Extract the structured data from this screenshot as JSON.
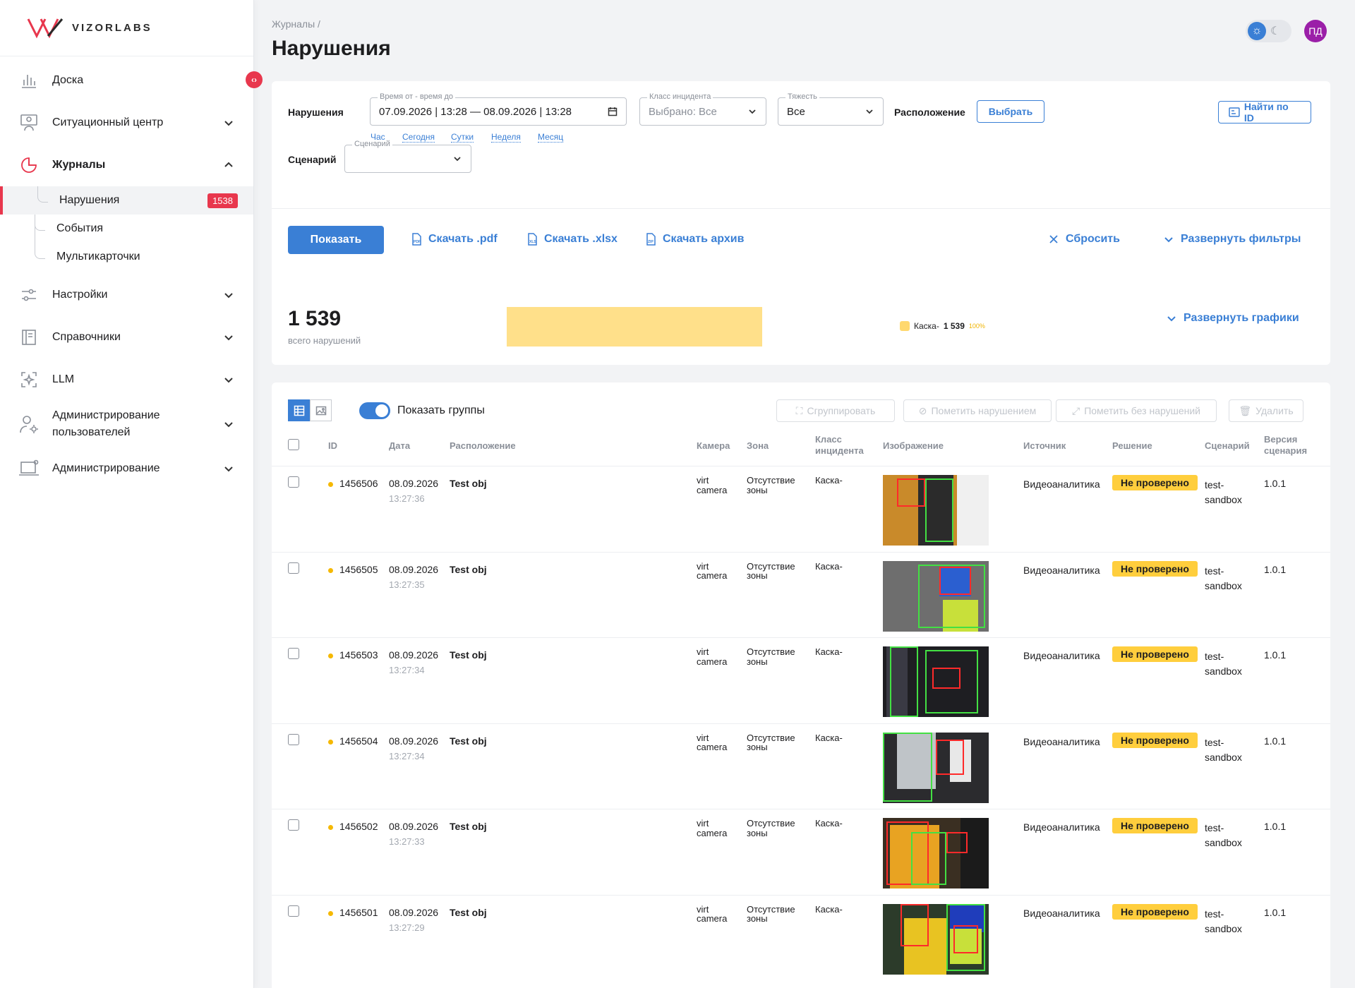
{
  "brand": {
    "logo_text": "VIZORLABS",
    "accent": "#e8374d",
    "primary": "#3a7fd5"
  },
  "sidebar": {
    "items": [
      {
        "label": "Доска",
        "icon": "chart-bars-icon"
      },
      {
        "label": "Ситуационный центр",
        "icon": "monitor-user-icon"
      },
      {
        "label": "Журналы",
        "icon": "pie-chart-icon"
      },
      {
        "label": "Настройки",
        "icon": "sliders-icon"
      },
      {
        "label": "Справочники",
        "icon": "book-icon"
      },
      {
        "label": "LLM",
        "icon": "ai-sparkle-icon"
      },
      {
        "label": "Администрирование пользователей",
        "icon": "user-gear-icon"
      },
      {
        "label": "Администрирование",
        "icon": "laptop-gear-icon"
      }
    ],
    "sub": [
      {
        "label": "Нарушения",
        "count": "1538"
      },
      {
        "label": "События"
      },
      {
        "label": "Мультикарточки"
      }
    ]
  },
  "header": {
    "breadcrumb": "Журналы /",
    "title": "Нарушения",
    "avatar": "ПД"
  },
  "filters": {
    "violations_label": "Нарушения",
    "time_legend": "Время от - время до",
    "time_value": "07.09.2026 | 13:28 — 08.09.2026 | 13:28",
    "quick": [
      "Час",
      "Сегодня",
      "Сутки",
      "Неделя",
      "Месяц"
    ],
    "class_legend": "Класс инцидента",
    "class_value": "Выбрано: Все",
    "severity_legend": "Тяжесть",
    "severity_value": "Все",
    "location_label": "Расположение",
    "choose_btn": "Выбрать",
    "find_id_btn": "Найти по ID",
    "scenario_label": "Сценарий",
    "scenario_legend": "Сценарий",
    "scenario_value": "",
    "show_btn": "Показать",
    "pdf_btn": "Скачать .pdf",
    "xlsx_btn": "Скачать .xlsx",
    "archive_btn": "Скачать архив",
    "reset_btn": "Сбросить",
    "expand_filters_btn": "Развернуть фильтры"
  },
  "stats": {
    "total": "1 539",
    "total_label": "всего нарушений",
    "share": 1.0,
    "legend_name": "Каска-",
    "legend_count": "1 539",
    "legend_pct": "100%",
    "expand_charts_btn": "Развернуть графики"
  },
  "table": {
    "show_groups": "Показать группы",
    "actions": {
      "group": "Сгруппировать",
      "mark_violation": "Пометить нарушением",
      "mark_no_violation": "Пометить без нарушений",
      "delete": "Удалить"
    },
    "headers": {
      "id": "ID",
      "date": "Дата",
      "location": "Расположение",
      "camera": "Камера",
      "zone": "Зона",
      "incident_class": "Класс инцидента",
      "image": "Изображение",
      "source": "Источник",
      "decision": "Решение",
      "scenario": "Сценарий",
      "scenario_version": "Версия сценария"
    },
    "rows": [
      {
        "id": "1456506",
        "date": "08.09.2026",
        "time": "13:27:36",
        "location": "Test obj",
        "camera": "virt camera",
        "zone": "Отсутствие зоны",
        "class": "Каска-",
        "source": "Видеоаналитика",
        "decision": "Не проверено",
        "scenario": "test-sandbox",
        "version": "1.0.1"
      },
      {
        "id": "1456505",
        "date": "08.09.2026",
        "time": "13:27:35",
        "location": "Test obj",
        "camera": "virt camera",
        "zone": "Отсутствие зоны",
        "class": "Каска-",
        "source": "Видеоаналитика",
        "decision": "Не проверено",
        "scenario": "test-sandbox",
        "version": "1.0.1"
      },
      {
        "id": "1456503",
        "date": "08.09.2026",
        "time": "13:27:34",
        "location": "Test obj",
        "camera": "virt camera",
        "zone": "Отсутствие зоны",
        "class": "Каска-",
        "source": "Видеоаналитика",
        "decision": "Не проверено",
        "scenario": "test-sandbox",
        "version": "1.0.1"
      },
      {
        "id": "1456504",
        "date": "08.09.2026",
        "time": "13:27:34",
        "location": "Test obj",
        "camera": "virt camera",
        "zone": "Отсутствие зоны",
        "class": "Каска-",
        "source": "Видеоаналитика",
        "decision": "Не проверено",
        "scenario": "test-sandbox",
        "version": "1.0.1"
      },
      {
        "id": "1456502",
        "date": "08.09.2026",
        "time": "13:27:33",
        "location": "Test obj",
        "camera": "virt camera",
        "zone": "Отсутствие зоны",
        "class": "Каска-",
        "source": "Видеоаналитика",
        "decision": "Не проверено",
        "scenario": "test-sandbox",
        "version": "1.0.1"
      },
      {
        "id": "1456501",
        "date": "08.09.2026",
        "time": "13:27:29",
        "location": "Test obj",
        "camera": "virt camera",
        "zone": "Отсутствие зоны",
        "class": "Каска-",
        "source": "Видеоаналитика",
        "decision": "Не проверено",
        "scenario": "test-sandbox",
        "version": "1.0.1"
      }
    ]
  }
}
